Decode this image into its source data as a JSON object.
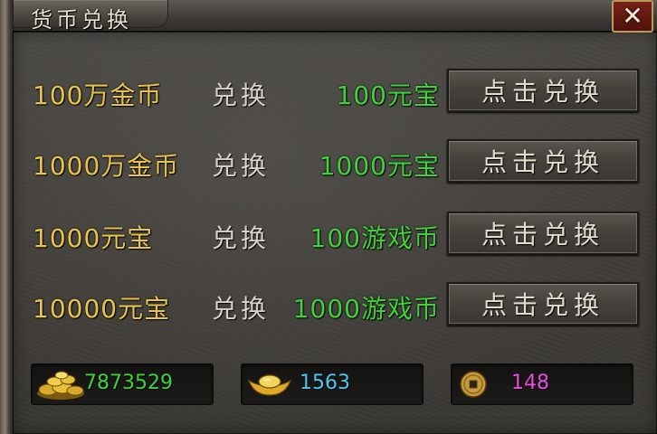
{
  "window": {
    "title": "货币兑换",
    "close_label": "✕"
  },
  "exchanges": [
    {
      "cost": "100万金币",
      "verb": "兑换",
      "gain": "100元宝",
      "button": "点击兑换"
    },
    {
      "cost": "1000万金币",
      "verb": "兑换",
      "gain": "1000元宝",
      "button": "点击兑换"
    },
    {
      "cost": "1000元宝",
      "verb": "兑换",
      "gain": "100游戏币",
      "button": "点击兑换"
    },
    {
      "cost": "10000元宝",
      "verb": "兑换",
      "gain": "1000游戏币",
      "button": "点击兑换"
    }
  ],
  "wallet": {
    "gold": {
      "icon": "gold-coin-pile-icon",
      "value": "7873529",
      "color": "#3fd23a"
    },
    "yuanbao": {
      "icon": "gold-ingot-icon",
      "value": "1563",
      "color": "#4fc7ef"
    },
    "game_coin": {
      "icon": "copper-coin-icon",
      "value": "148",
      "color": "#e64fe0"
    }
  },
  "colors": {
    "cost_text": "#e9c44a",
    "gain_text": "#3fd23a",
    "verb_text": "#d8d4cb"
  }
}
